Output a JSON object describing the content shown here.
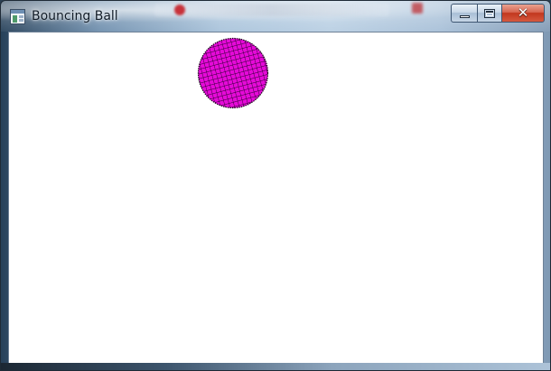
{
  "window": {
    "title": "Bouncing Ball"
  },
  "caption_buttons": {
    "minimize": "minimize-icon",
    "maximize": "maximize-icon",
    "close": "close-icon",
    "close_glyph": "✕"
  },
  "ball": {
    "fill_color": "#e60ad8",
    "grid_color": "#2a0030",
    "outline_color": "#1a001a"
  },
  "colors": {
    "client_background": "#ffffff",
    "frame": "#a9c3db"
  }
}
